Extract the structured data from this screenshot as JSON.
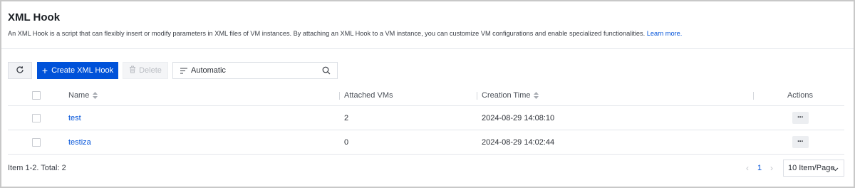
{
  "header": {
    "title": "XML Hook",
    "description": "An XML Hook is a script that can flexibly insert or modify parameters in XML files of VM instances. By attaching an XML Hook to a VM instance, you can customize VM configurations and enable specialized functionalities.",
    "learn_more": "Learn more."
  },
  "toolbar": {
    "refresh_icon": "refresh-icon",
    "create_label": "Create XML Hook",
    "delete_label": "Delete",
    "search_value": "Automatic"
  },
  "table": {
    "columns": {
      "name": "Name",
      "attached_vms": "Attached VMs",
      "creation_time": "Creation Time",
      "actions": "Actions"
    },
    "rows": [
      {
        "name": "test",
        "attached_vms": "2",
        "creation_time": "2024-08-29 14:08:10",
        "actions": "···"
      },
      {
        "name": "testiza",
        "attached_vms": "0",
        "creation_time": "2024-08-29 14:02:44",
        "actions": "···"
      }
    ]
  },
  "footer": {
    "total_text": "Item 1-2. Total: 2",
    "current_page": "1",
    "page_size": "10 Item/Page"
  },
  "colors": {
    "primary": "#0052d9",
    "border": "#e3e6eb"
  }
}
